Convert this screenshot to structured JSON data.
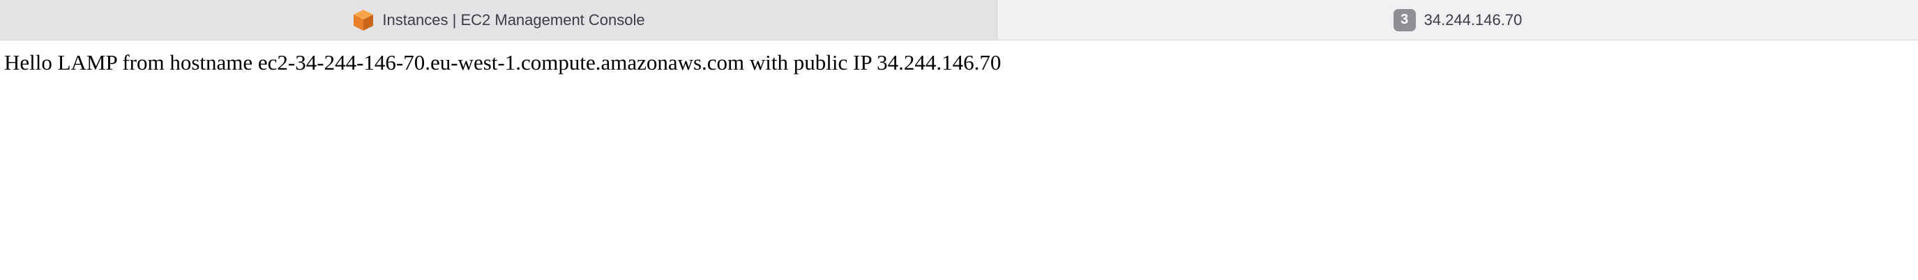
{
  "tabs": [
    {
      "title": "Instances | EC2 Management Console",
      "icon": "aws-cube-icon",
      "active": false
    },
    {
      "title": "34.244.146.70",
      "badge": "3",
      "active": true
    }
  ],
  "page": {
    "text": "Hello LAMP from hostname ec2-34-244-146-70.eu-west-1.compute.amazonaws.com with public IP 34.244.146.70"
  },
  "colors": {
    "favicon_orange": "#f0892a",
    "favicon_dark": "#c9661a",
    "badge_bg": "#8e8e93"
  }
}
